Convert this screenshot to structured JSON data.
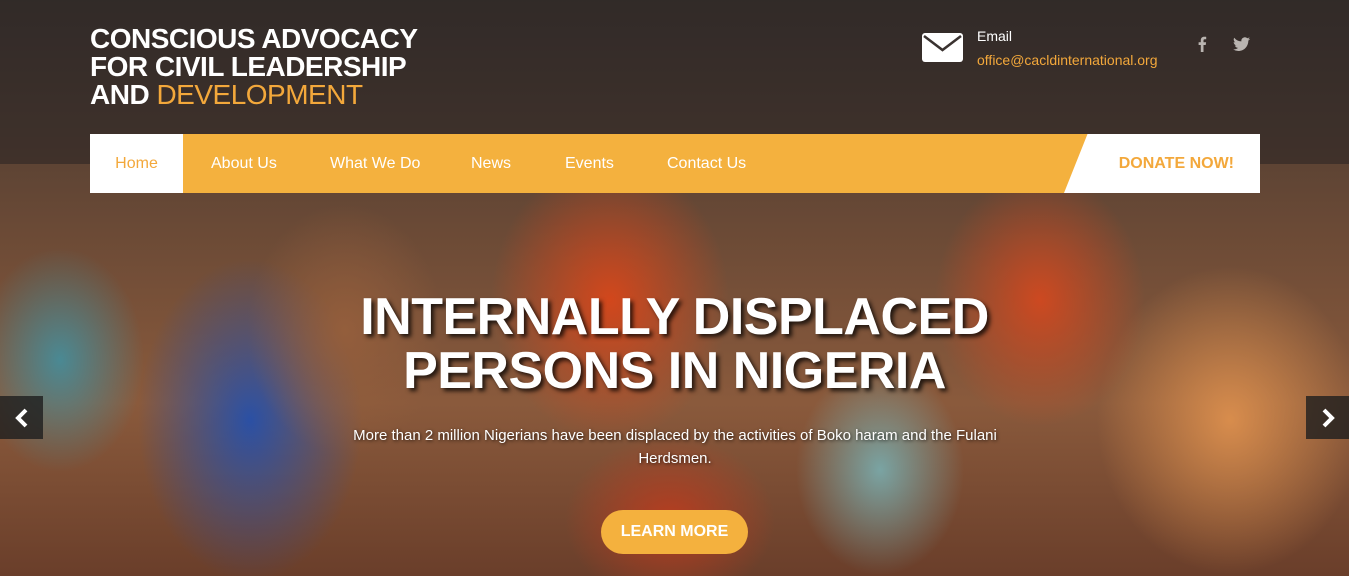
{
  "header": {
    "logo_line1": "CONSCIOUS ADVOCACY",
    "logo_line2": "FOR CIVIL LEADERSHIP",
    "logo_line3_prefix": "AND ",
    "logo_line3_accent": "DEVELOPMENT",
    "email_label": "Email",
    "email_value": "office@cacldinternational.org",
    "email_icon": "envelope-icon",
    "social": [
      "facebook-icon",
      "twitter-icon"
    ]
  },
  "nav": {
    "items": [
      {
        "label": "Home",
        "active": true
      },
      {
        "label": "About Us"
      },
      {
        "label": "What We Do"
      },
      {
        "label": "News"
      },
      {
        "label": "Events"
      },
      {
        "label": "Contact Us"
      }
    ],
    "donate_label": "DONATE NOW!"
  },
  "hero": {
    "title_line1": "INTERNALLY DISPLACED",
    "title_line2": "PERSONS IN NIGERIA",
    "description": "More than 2 million Nigerians have been displaced by the activities of Boko haram and the Fulani Herdsmen.",
    "button_label": "LEARN MORE",
    "prev_icon": "chevron-left-icon",
    "next_icon": "chevron-right-icon"
  },
  "colors": {
    "accent": "#f4b13e",
    "accent_text": "#f3a83b",
    "white": "#ffffff"
  }
}
